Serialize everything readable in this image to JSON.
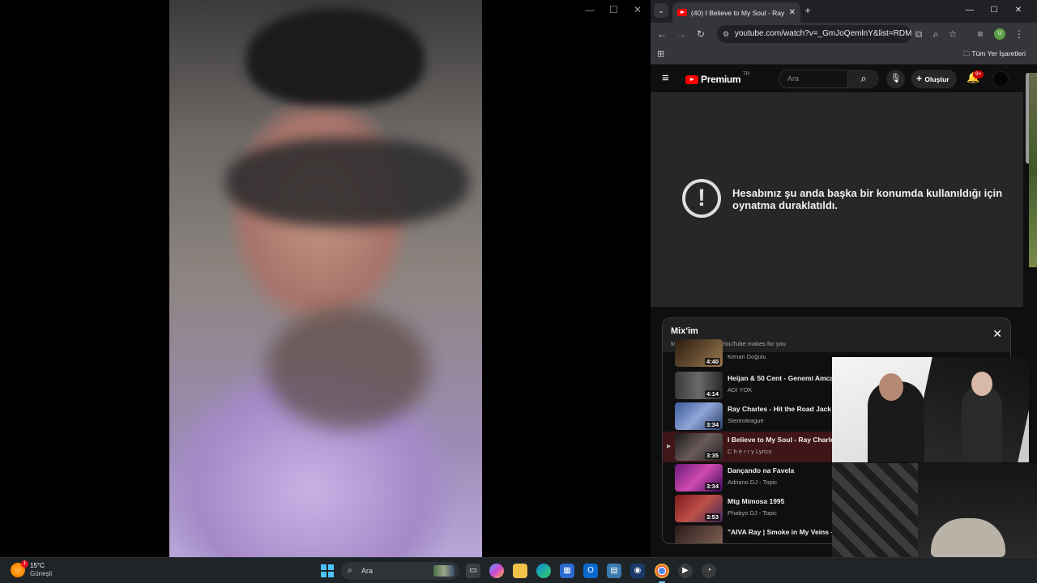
{
  "left_window": {
    "minimize": "—",
    "maximize": "☐",
    "close": "✕"
  },
  "browser": {
    "tab_title": "(40) I Believe to My Soul - Ray C",
    "tab_close": "✕",
    "new_tab": "+",
    "window_minimize": "—",
    "window_maximize": "☐",
    "window_close": "✕",
    "url": "youtube.com/watch?v=_GmJoQemlnY&list=RDM...",
    "bookmarks_all": "Tüm Yer İşaretleri",
    "profile_initial": "U"
  },
  "youtube": {
    "brand": "Premium",
    "region": "TR",
    "search_placeholder": "Ara",
    "create_label": "Oluştur",
    "notification_count": "9+",
    "error_symbol": "!",
    "error_message": "Hesabınız şu anda başka bir konumda kullanıldığı için oynatma duraklatıldı.",
    "mix": {
      "title": "Mix'im",
      "subtitle": "Mixes are playlists YouTube makes for you",
      "items": [
        {
          "title": "",
          "channel": "Kenan Doğulu",
          "duration": "4:40",
          "active": false
        },
        {
          "title": "Heijan & 50 Cent - Genemi Amcala",
          "channel": "ADI YOK",
          "duration": "4:14",
          "active": false
        },
        {
          "title": "Ray Charles - Hit the Road Jack on",
          "channel": "Stereoleague",
          "duration": "3:34",
          "active": false
        },
        {
          "title": "I Believe to My Soul - Ray Charles [",
          "channel": "C h è r r y Lyrics",
          "duration": "3:35",
          "active": true
        },
        {
          "title": "Dançando na Favela",
          "channel": "Adriano DJ - Topic",
          "duration": "3:34",
          "active": false
        },
        {
          "title": "Mtg Mimosa 1995",
          "channel": "Phabyo DJ - Topic",
          "duration": "3:53",
          "active": false
        },
        {
          "title": "\"AIVA Ray | Smoke in My Veins –",
          "channel": "",
          "duration": "",
          "active": false
        }
      ]
    }
  },
  "taskbar": {
    "temperature": "15°C",
    "weather_text": "Güneşli",
    "weather_badge": "1",
    "search_label": "Ara"
  },
  "colors": {
    "youtube_red": "#ff0000",
    "active_row": "#3f1518",
    "windows_accent": "#4cc2ff"
  }
}
